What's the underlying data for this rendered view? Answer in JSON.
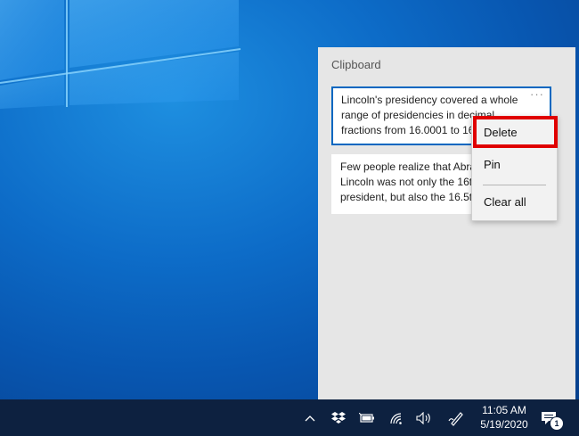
{
  "clipboard": {
    "title": "Clipboard",
    "items": [
      {
        "lines": [
          "Lincoln's presidency covered a whole",
          "range of presidencies in decimal",
          "fractions from 16.0001 to 16.9999"
        ],
        "more_label": "···"
      },
      {
        "lines": [
          "Few people realize that Abraham",
          "Lincoln was not only the 16th",
          "president, but also the 16.5th"
        ]
      }
    ]
  },
  "context_menu": {
    "items": [
      "Delete",
      "Pin",
      "Clear all"
    ]
  },
  "taskbar": {
    "time": "11:05 AM",
    "date": "5/19/2020",
    "notification_count": "1",
    "tray_icons": [
      "chevron-up-icon",
      "dropbox-icon",
      "battery-icon",
      "wifi-icon",
      "volume-icon",
      "pen-icon",
      "action-center-icon"
    ]
  },
  "colors": {
    "accent": "#0067c0",
    "highlight": "#e00000",
    "taskbar": "#0d2140"
  }
}
